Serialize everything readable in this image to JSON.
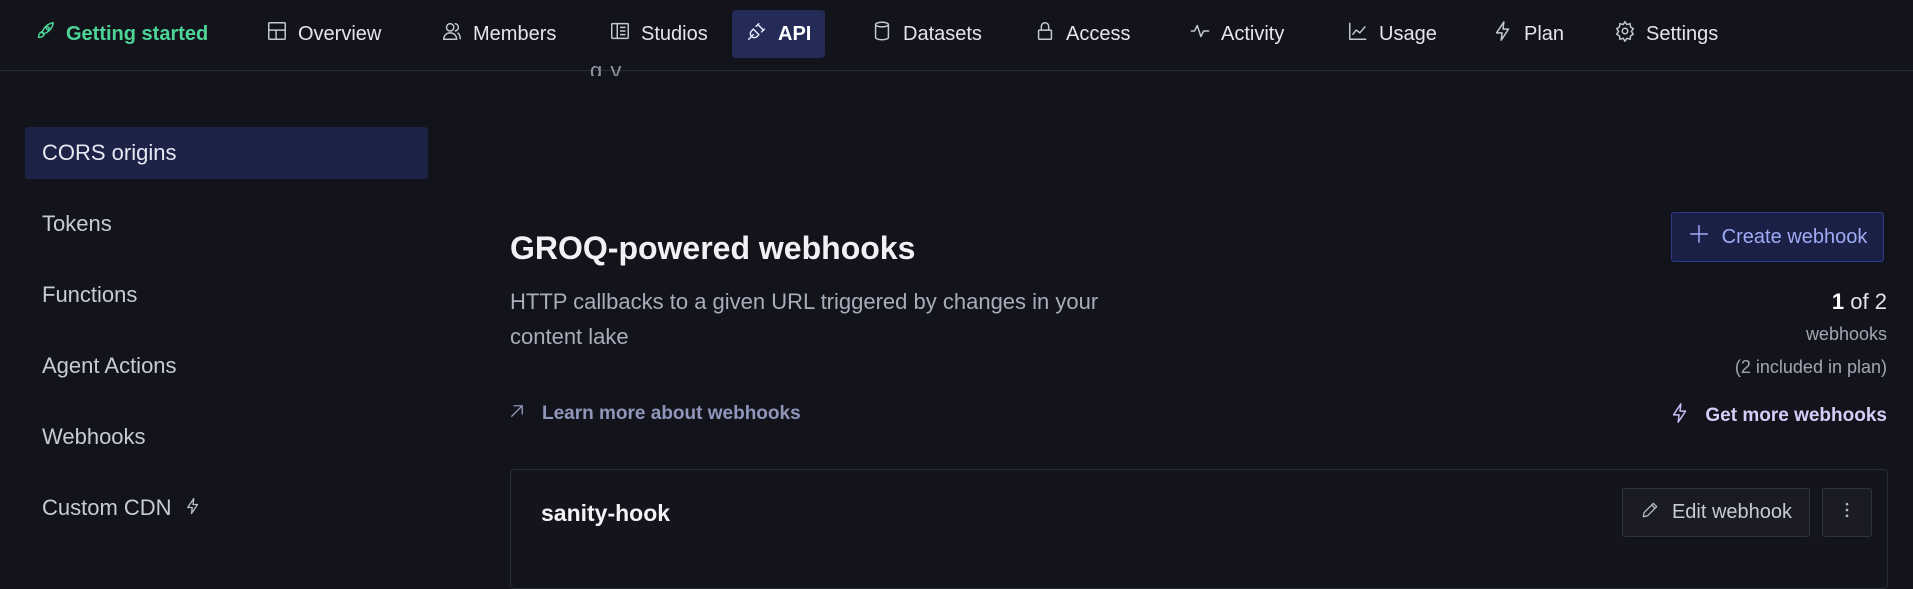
{
  "nav": {
    "getting_started": "Getting started",
    "overview": "Overview",
    "members": "Members",
    "studios": "Studios",
    "api": "API",
    "datasets": "Datasets",
    "access": "Access",
    "activity": "Activity",
    "usage": "Usage",
    "plan": "Plan",
    "settings": "Settings",
    "active_tab": "API"
  },
  "cutoff_text": "g        y",
  "sidebar": {
    "items": [
      {
        "label": "CORS origins",
        "active": true
      },
      {
        "label": "Tokens"
      },
      {
        "label": "Functions"
      },
      {
        "label": "Agent Actions"
      },
      {
        "label": "Webhooks"
      },
      {
        "label": "Custom CDN",
        "icon": "lightning-icon"
      }
    ]
  },
  "webhooks": {
    "title": "GROQ-powered webhooks",
    "description": "HTTP callbacks to a given URL triggered by changes in your content lake",
    "create_button": "Create webhook",
    "quota_used": "1",
    "quota_of": "of 2",
    "quota_unit": "webhooks",
    "quota_plan": "(2 included in plan)",
    "learn_link": "Learn more about webhooks",
    "more_link": "Get more webhooks",
    "items": [
      {
        "name": "sanity-hook",
        "edit_label": "Edit webhook"
      }
    ]
  },
  "colors": {
    "background": "#13141b",
    "active_nav": "#232b56",
    "accent_green": "#4dd598",
    "accent_blue": "#9eacf5",
    "accent_purple": "#d7ccf7"
  }
}
